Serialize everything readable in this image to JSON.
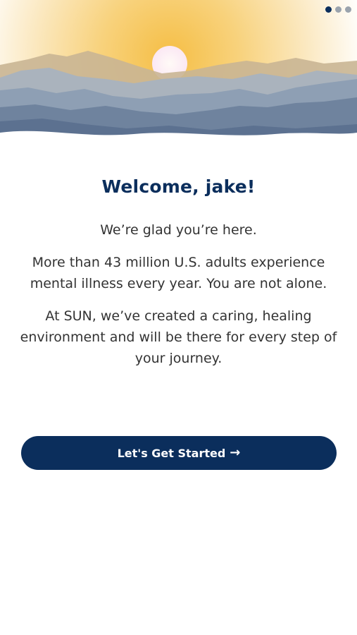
{
  "pager": {
    "count": 3,
    "active_index": 0
  },
  "welcome": {
    "title": "Welcome, jake!",
    "lead": "We’re glad you’re here.",
    "paragraphs": [
      "More than 43 million U.S. adults experience mental illness every year. You are not alone.",
      "At SUN, we’ve created a caring, healing environment and will be there for every step of your journey."
    ]
  },
  "cta": {
    "label": "Let's Get Started",
    "icon": "arrow-right-icon"
  },
  "colors": {
    "primary": "#0b2e5c",
    "text": "#333333",
    "dot_inactive": "#9aa3ad",
    "sun_glow": "#f5c04a"
  }
}
